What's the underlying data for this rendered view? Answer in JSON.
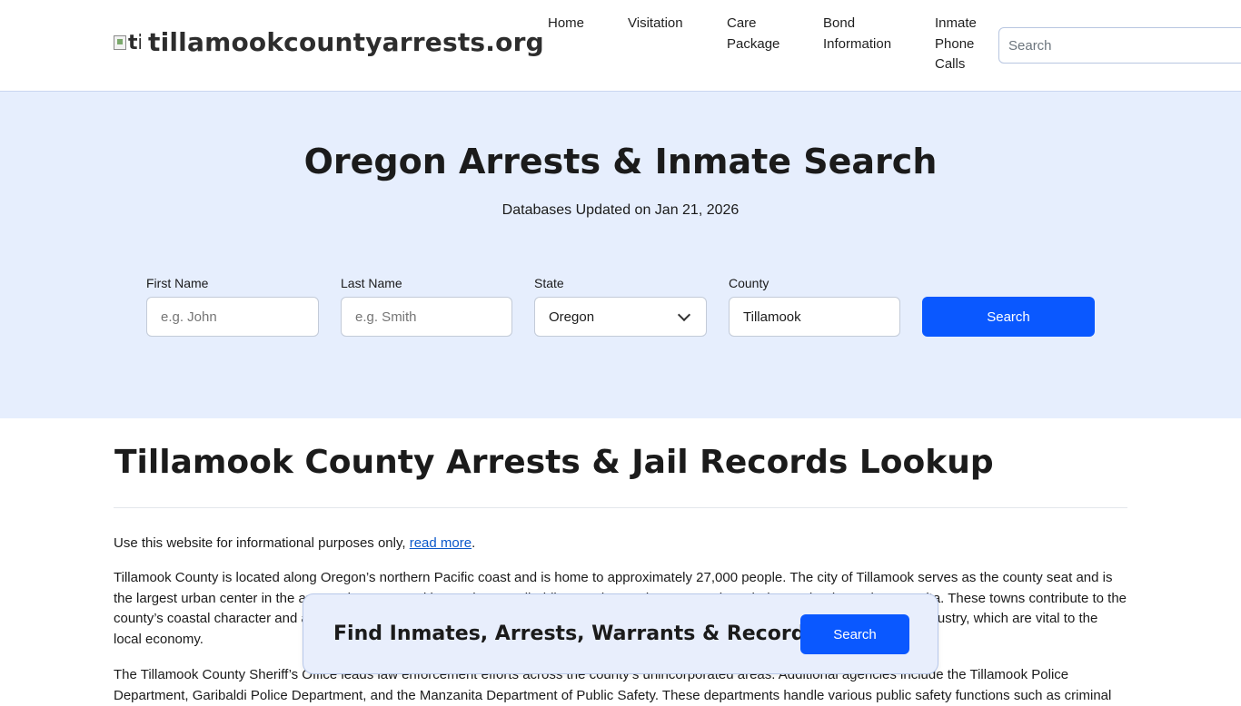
{
  "header": {
    "logo_alt": "ti",
    "site_name": "tillamookcountyarrests.org",
    "nav": {
      "home": "Home",
      "visitation": "Visitation",
      "care_package": "Care Package",
      "bond_information": "Bond Information",
      "inmate_phone_calls": "Inmate Phone Calls"
    },
    "search_placeholder": "Search"
  },
  "hero": {
    "title": "Oregon Arrests & Inmate Search",
    "subtitle": "Databases Updated on Jan 21, 2026",
    "form": {
      "first_name_label": "First Name",
      "first_name_placeholder": "e.g. John",
      "last_name_label": "Last Name",
      "last_name_placeholder": "e.g. Smith",
      "state_label": "State",
      "state_value": "Oregon",
      "county_label": "County",
      "county_value": "Tillamook",
      "search_button": "Search"
    }
  },
  "main": {
    "title": "Tillamook County Arrests & Jail Records Lookup",
    "disclaimer_text": "Use this website for informational purposes only, ",
    "disclaimer_link": "read more",
    "disclaimer_end": ".",
    "paragraph_2": "Tillamook County is located along Oregon’s northern Pacific coast and is home to approximately 27,000 people. The city of Tillamook serves as the county seat and is the largest urban center in the area. Other communities such as Garibaldi, Bay City, Rockaway Beach, Nehalem, Wheeler and Manzanita. These towns contribute to the county’s coastal character and are hubs for tourism, agriculture, and recreation activities, as well as for the dairy farming and seafood industry, which are vital to the local economy.",
    "paragraph_3": "The Tillamook County Sheriff’s Office leads law enforcement efforts across the county’s unincorporated areas. Additional agencies include the Tillamook Police Department, Garibaldi Police Department, and the Manzanita Department of Public Safety. These departments handle various public safety functions such as criminal"
  },
  "banner": {
    "text": "Find Inmates, Arrests, Warrants & Records",
    "button": "Search"
  },
  "colors": {
    "accent": "#0a58ff",
    "hero_bg": "#e6eefd",
    "link": "#0a58ca"
  }
}
